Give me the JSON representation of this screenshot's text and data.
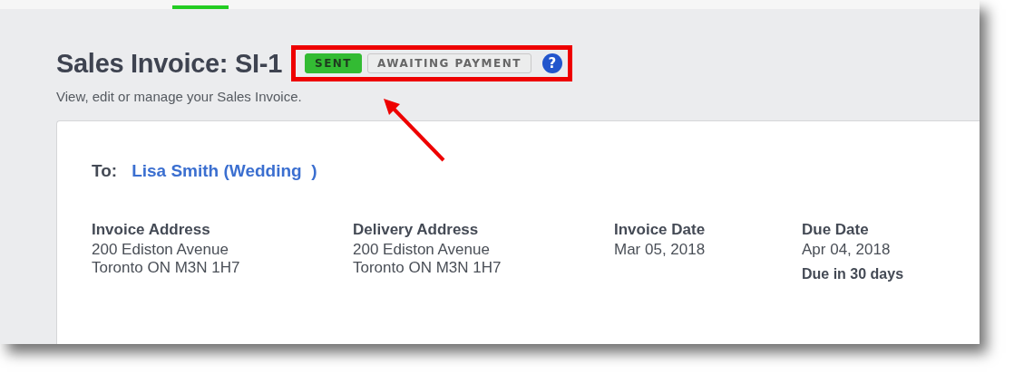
{
  "title": "Sales Invoice: SI-1",
  "badges": [
    {
      "label": "SENT",
      "kind": "success"
    },
    {
      "label": "AWAITING PAYMENT",
      "kind": "neutral"
    }
  ],
  "help": "?",
  "subtitle": "View, edit or manage your Sales Invoice.",
  "to": {
    "label": "To:",
    "customer": "Lisa Smith (Wedding  )"
  },
  "columns": [
    {
      "heading": "Invoice Address",
      "lines": [
        "200 Ediston Avenue",
        "Toronto ON M3N 1H7"
      ]
    },
    {
      "heading": "Delivery Address",
      "lines": [
        "200 Ediston Avenue",
        "Toronto ON M3N 1H7"
      ]
    },
    {
      "heading": "Invoice Date",
      "lines": [
        "Mar 05, 2018"
      ]
    },
    {
      "heading": "Due Date",
      "lines": [
        "Apr 04, 2018"
      ],
      "note": "Due in 30 days"
    }
  ]
}
